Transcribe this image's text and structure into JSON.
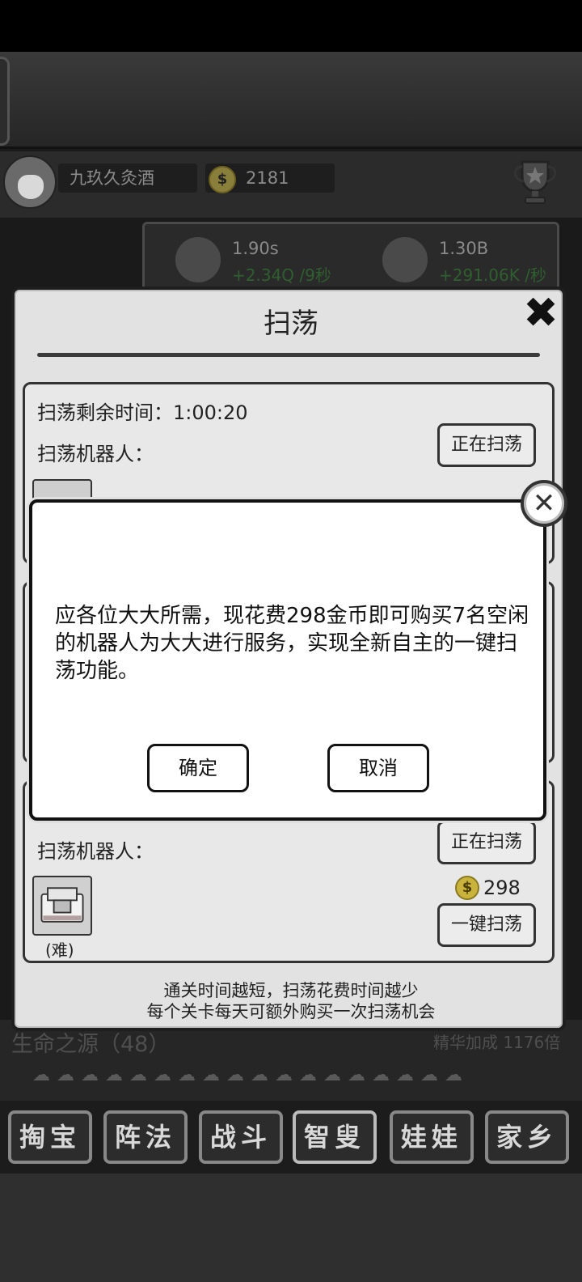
{
  "header": {
    "player_name": "九玖久灸酒",
    "coins": "2181",
    "coin_symbol": "$"
  },
  "resources": [
    {
      "name": "resource-time",
      "value": "1.90s",
      "rate": "+2.34Q /9秒"
    },
    {
      "name": "resource-crystal",
      "value": "1.30B",
      "rate": "+291.06K /秒"
    }
  ],
  "background": {
    "life_source": "生命之源（48）",
    "essence_bonus": "精华加成 1176倍"
  },
  "bottom_nav": [
    "掏宝",
    "阵法",
    "战斗",
    "智叟",
    "娃娃",
    "家乡"
  ],
  "sweep_dialog": {
    "title": "扫荡",
    "close_glyph": "✖",
    "card1": {
      "time_label": "扫荡剩余时间：1:00:20",
      "robots_label": "扫荡机器人：",
      "status_button": "正在扫荡"
    },
    "card3": {
      "robots_label": "扫荡机器人：",
      "status_button": "正在扫荡",
      "difficulty": "(难)",
      "cost": "298",
      "one_click_button": "一键扫荡"
    },
    "footer_line1": "通关时间越短，扫荡花费时间越少",
    "footer_line2": "每个关卡每天可额外购买一次扫荡机会"
  },
  "popup": {
    "message": "应各位大大所需，现花费298金币即可购买7名空闲的机器人为大大进行服务，实现全新自主的一键扫荡功能。",
    "confirm_label": "确定",
    "cancel_label": "取消",
    "close_glyph": "✕"
  }
}
